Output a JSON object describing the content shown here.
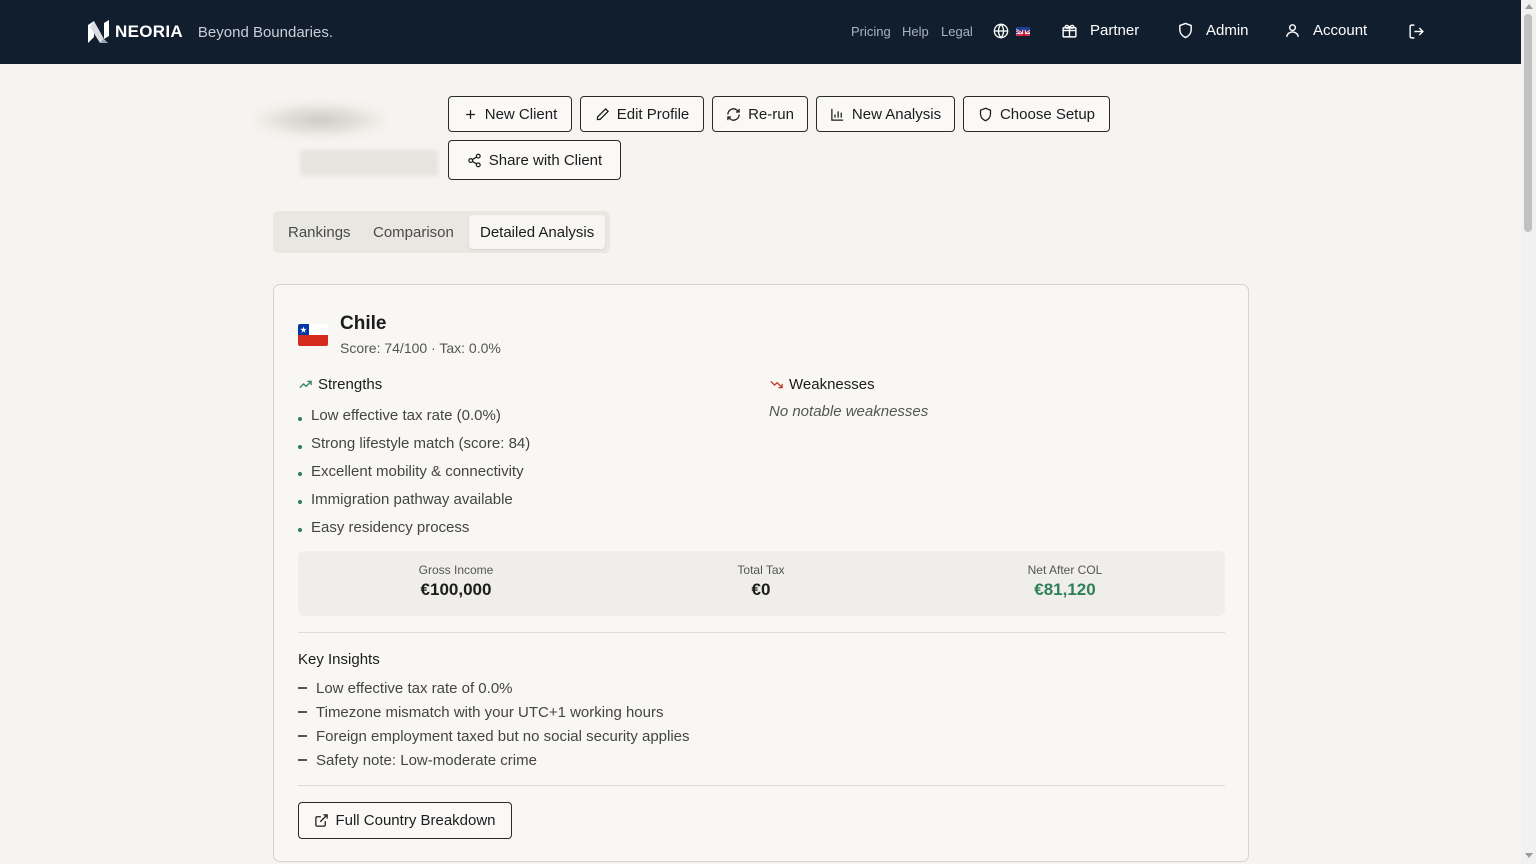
{
  "brand": {
    "name": "NEORIA",
    "tagline": "Beyond Boundaries."
  },
  "topnav": {
    "links": [
      "Pricing",
      "Help",
      "Legal"
    ],
    "language_icon": "globe-icon",
    "flag": "uk-flag",
    "partner": "Partner",
    "admin": "Admin",
    "account": "Account",
    "logout_icon": "logout-icon"
  },
  "actions": {
    "new_client": "New Client",
    "edit_profile": "Edit Profile",
    "rerun": "Re-run",
    "new_analysis": "New Analysis",
    "choose_setup": "Choose Setup",
    "share": "Share with Client"
  },
  "tabs": [
    "Rankings",
    "Comparison",
    "Detailed Analysis"
  ],
  "active_tab": "Detailed Analysis",
  "country": {
    "name": "Chile",
    "subtitle": "Score: 74/100 · Tax: 0.0%",
    "strengths_title": "Strengths",
    "strengths": [
      "Low effective tax rate (0.0%)",
      "Strong lifestyle match (score: 84)",
      "Excellent mobility & connectivity",
      "Immigration pathway available",
      "Easy residency process"
    ],
    "weaknesses_title": "Weaknesses",
    "weaknesses_empty": "No notable weaknesses",
    "financials": {
      "gross_label": "Gross Income",
      "gross_value": "€100,000",
      "tax_label": "Total Tax",
      "tax_value": "€0",
      "net_label": "Net After COL",
      "net_value": "€81,120"
    },
    "insights_title": "Key Insights",
    "insights": [
      "Low effective tax rate of 0.0%",
      "Timezone mismatch with your UTC+1 working hours",
      "Foreign employment taxed but no social security applies",
      "Safety note: Low-moderate crime"
    ],
    "full_breakdown": "Full Country Breakdown"
  },
  "colors": {
    "nav_bg": "#101e2e",
    "positive": "#2f7f58",
    "negative": "#c0392b",
    "page_bg": "#f5f4f0"
  }
}
